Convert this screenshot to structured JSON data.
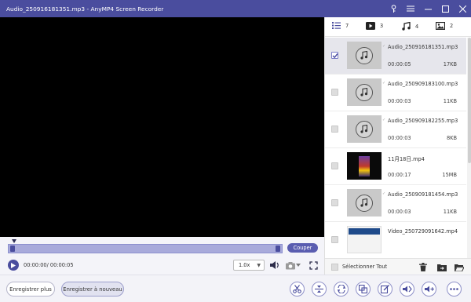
{
  "window": {
    "file_title": "Audio_250916181351.mp3",
    "separator": "-",
    "app_name": "AnyMP4 Screen Recorder"
  },
  "player": {
    "cut_label": "Couper",
    "time_readout": "00:00:00/ 00:00:05",
    "speed": "1.0x"
  },
  "tabs": [
    {
      "icon": "list-icon",
      "count": "7"
    },
    {
      "icon": "video-icon",
      "count": "3"
    },
    {
      "icon": "music-icon",
      "count": "4"
    },
    {
      "icon": "image-icon",
      "count": "2"
    }
  ],
  "files": [
    {
      "name": "Audio_250916181351.mp3",
      "duration": "00:00:05",
      "size": "17KB",
      "type": "audio",
      "checked": true
    },
    {
      "name": "Audio_250909183100.mp3",
      "duration": "00:00:03",
      "size": "11KB",
      "type": "audio",
      "checked": false
    },
    {
      "name": "Audio_250909182255.mp3",
      "duration": "00:00:03",
      "size": "8KB",
      "type": "audio",
      "checked": false
    },
    {
      "name": "11月18日.mp4",
      "duration": "00:00:17",
      "size": "15MB",
      "type": "video",
      "checked": false
    },
    {
      "name": "Audio_250909181454.mp3",
      "duration": "00:00:03",
      "size": "11KB",
      "type": "audio",
      "checked": false
    },
    {
      "name": "Video_250729091642.mp4",
      "duration": "",
      "size": "",
      "type": "video",
      "checked": false
    }
  ],
  "footer": {
    "select_all": "Sélectionner Tout"
  },
  "bottom": {
    "record_more": "Enregistrer plus",
    "record_new": "Enregistrer à nouveau"
  },
  "colors": {
    "titlebar": "#4a4d9e",
    "accent": "#5a5db0",
    "timeline": "#a8aadb"
  }
}
